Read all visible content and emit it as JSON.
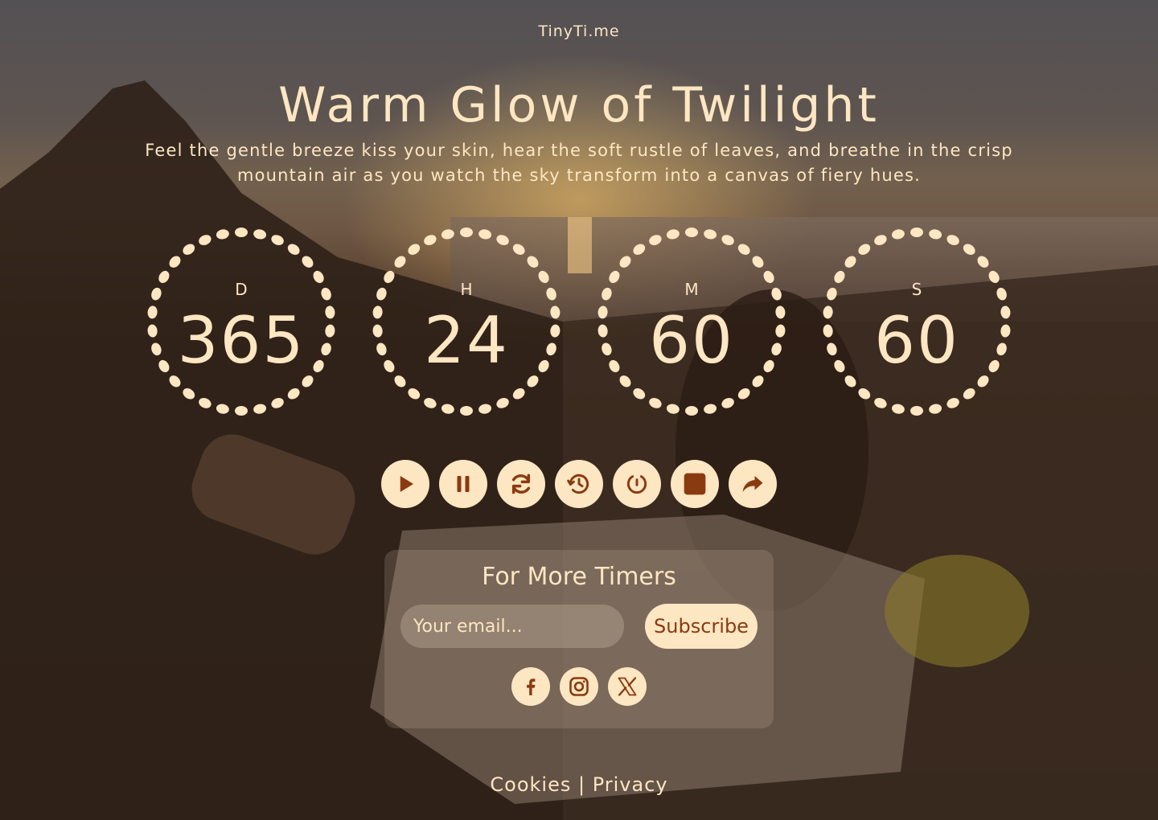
{
  "brand": "TinyTi.me",
  "title": "Warm Glow of Twilight",
  "subtitle": "Feel the gentle breeze kiss your skin, hear the soft rustle of leaves, and breathe in the crisp mountain air as you watch the sky transform into a canvas of fiery hues.",
  "timers": [
    {
      "label": "D",
      "value": "365"
    },
    {
      "label": "H",
      "value": "24"
    },
    {
      "label": "M",
      "value": "60"
    },
    {
      "label": "S",
      "value": "60"
    }
  ],
  "controls": [
    {
      "name": "play",
      "icon": "play-icon"
    },
    {
      "name": "pause",
      "icon": "pause-icon"
    },
    {
      "name": "restart",
      "icon": "refresh-icon"
    },
    {
      "name": "history",
      "icon": "history-icon"
    },
    {
      "name": "reset",
      "icon": "reset-icon"
    },
    {
      "name": "stop",
      "icon": "stop-icon"
    },
    {
      "name": "share",
      "icon": "share-icon"
    }
  ],
  "subscribe": {
    "heading": "For More Timers",
    "placeholder": "Your email...",
    "button": "Subscribe"
  },
  "social": [
    "facebook-icon",
    "instagram-icon",
    "x-icon"
  ],
  "footer": {
    "cookies": "Cookies",
    "separator": "|",
    "privacy": "Privacy"
  },
  "colors": {
    "cream": "#fde6c2",
    "accent": "#8a3a10"
  }
}
